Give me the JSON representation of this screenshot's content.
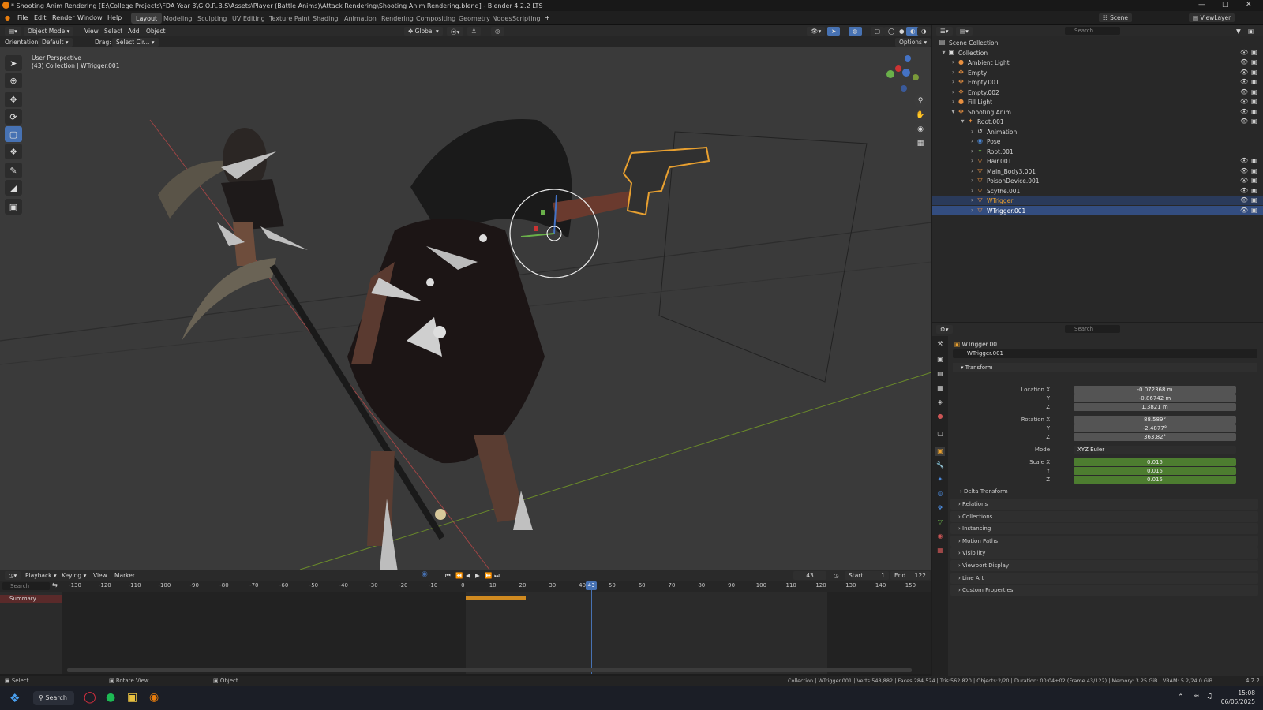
{
  "window": {
    "title": "* Shooting Anim Rendering [E:\\College Projects\\FDA Year 3\\G.O.R.B.S\\Assets\\Player (Battle Anims)\\Attack Rendering\\Shooting Anim Rendering.blend] - Blender 4.2.2 LTS"
  },
  "menu": [
    "File",
    "Edit",
    "Render",
    "Window",
    "Help"
  ],
  "workspaces": [
    "Layout",
    "Modeling",
    "Sculpting",
    "UV Editing",
    "Texture Paint",
    "Shading",
    "Animation",
    "Rendering",
    "Compositing",
    "Geometry Nodes",
    "Scripting"
  ],
  "active_workspace": "Layout",
  "top_right": {
    "scene": "Scene",
    "view_layer": "ViewLayer"
  },
  "viewport": {
    "mode": "Object Mode",
    "menus": [
      "View",
      "Select",
      "Add",
      "Object"
    ],
    "transform_orientation": "Global",
    "orientation_label": "Orientation:",
    "orientation_value": "Default",
    "drag_label": "Drag:",
    "drag_value": "Select Cir...",
    "options_label": "Options",
    "overlay_line1": "User Perspective",
    "overlay_line2": "(43) Collection | WTrigger.001"
  },
  "outliner": {
    "search_placeholder": "Search",
    "rows": [
      {
        "name": "Scene Collection",
        "indent": 0,
        "icon": "scene"
      },
      {
        "name": "Collection",
        "indent": 1,
        "icon": "collection"
      },
      {
        "name": "Ambient Light",
        "indent": 2,
        "icon": "light"
      },
      {
        "name": "Empty",
        "indent": 2,
        "icon": "empty"
      },
      {
        "name": "Empty.001",
        "indent": 2,
        "icon": "empty"
      },
      {
        "name": "Empty.002",
        "indent": 2,
        "icon": "empty"
      },
      {
        "name": "Fill Light",
        "indent": 2,
        "icon": "light"
      },
      {
        "name": "Shooting Anim",
        "indent": 2,
        "icon": "empty"
      },
      {
        "name": "Root.001",
        "indent": 3,
        "icon": "armature"
      },
      {
        "name": "Animation",
        "indent": 4,
        "icon": "action"
      },
      {
        "name": "Pose",
        "indent": 4,
        "icon": "pose"
      },
      {
        "name": "Root.001",
        "indent": 4,
        "icon": "bone"
      },
      {
        "name": "Hair.001",
        "indent": 4,
        "icon": "mesh"
      },
      {
        "name": "Main_Body3.001",
        "indent": 4,
        "icon": "mesh"
      },
      {
        "name": "PoisonDevice.001",
        "indent": 4,
        "icon": "mesh"
      },
      {
        "name": "Scythe.001",
        "indent": 4,
        "icon": "mesh"
      },
      {
        "name": "WTrigger",
        "indent": 4,
        "icon": "mesh",
        "selected": "parent"
      },
      {
        "name": "WTrigger.001",
        "indent": 4,
        "icon": "mesh",
        "selected": "active"
      }
    ]
  },
  "properties": {
    "search_placeholder": "Search",
    "object_name": "WTrigger.001",
    "datablock_name": "WTrigger.001",
    "transform_label": "Transform",
    "location": {
      "label": "Location X",
      "x": "-0.072368 m",
      "y": "-0.86742 m",
      "z": "1.3821 m"
    },
    "rotation": {
      "label": "Rotation X",
      "x": "88.589°",
      "y": "-2.4877°",
      "z": "363.82°"
    },
    "mode_label": "Mode",
    "mode_value": "XYZ Euler",
    "scale": {
      "label": "Scale X",
      "x": "0.015",
      "y": "0.015",
      "z": "0.015"
    },
    "axis_y": "Y",
    "axis_z": "Z",
    "delta_transform": "Delta Transform",
    "panels": [
      "Relations",
      "Collections",
      "Instancing",
      "Motion Paths",
      "Visibility",
      "Viewport Display",
      "Line Art",
      "Custom Properties"
    ]
  },
  "timeline": {
    "menus": [
      "Playback",
      "Keying",
      "View",
      "Marker"
    ],
    "current_frame": "43",
    "start_label": "Start",
    "start": "1",
    "end_label": "End",
    "end": "122",
    "search_placeholder": "Search",
    "summary_label": "Summary",
    "ticks": [
      -130,
      -120,
      -110,
      -100,
      -90,
      -80,
      -70,
      -60,
      -50,
      -40,
      -30,
      -20,
      -10,
      0,
      10,
      20,
      30,
      40,
      50,
      60,
      70,
      80,
      90,
      100,
      110,
      120,
      130,
      140,
      150
    ],
    "playhead": "43"
  },
  "status": {
    "select": "Select",
    "rotate": "Rotate View",
    "object": "Object",
    "info": "Collection | WTrigger.001 | Verts:548,882 | Faces:284,524 | Tris:562,820 | Objects:2/20 | Duration: 00:04+02 (Frame 43/122) | Memory: 3.25 GiB | VRAM: 5.2/24.0 GiB",
    "version": "4.2.2"
  },
  "taskbar": {
    "search": "Search",
    "time": "15:08",
    "date": "06/05/2025"
  },
  "colors": {
    "accent": "#4772b3",
    "selection_orange": "#e8a030",
    "scale_green": "#4d7d30",
    "playhead": "#4772b3"
  }
}
